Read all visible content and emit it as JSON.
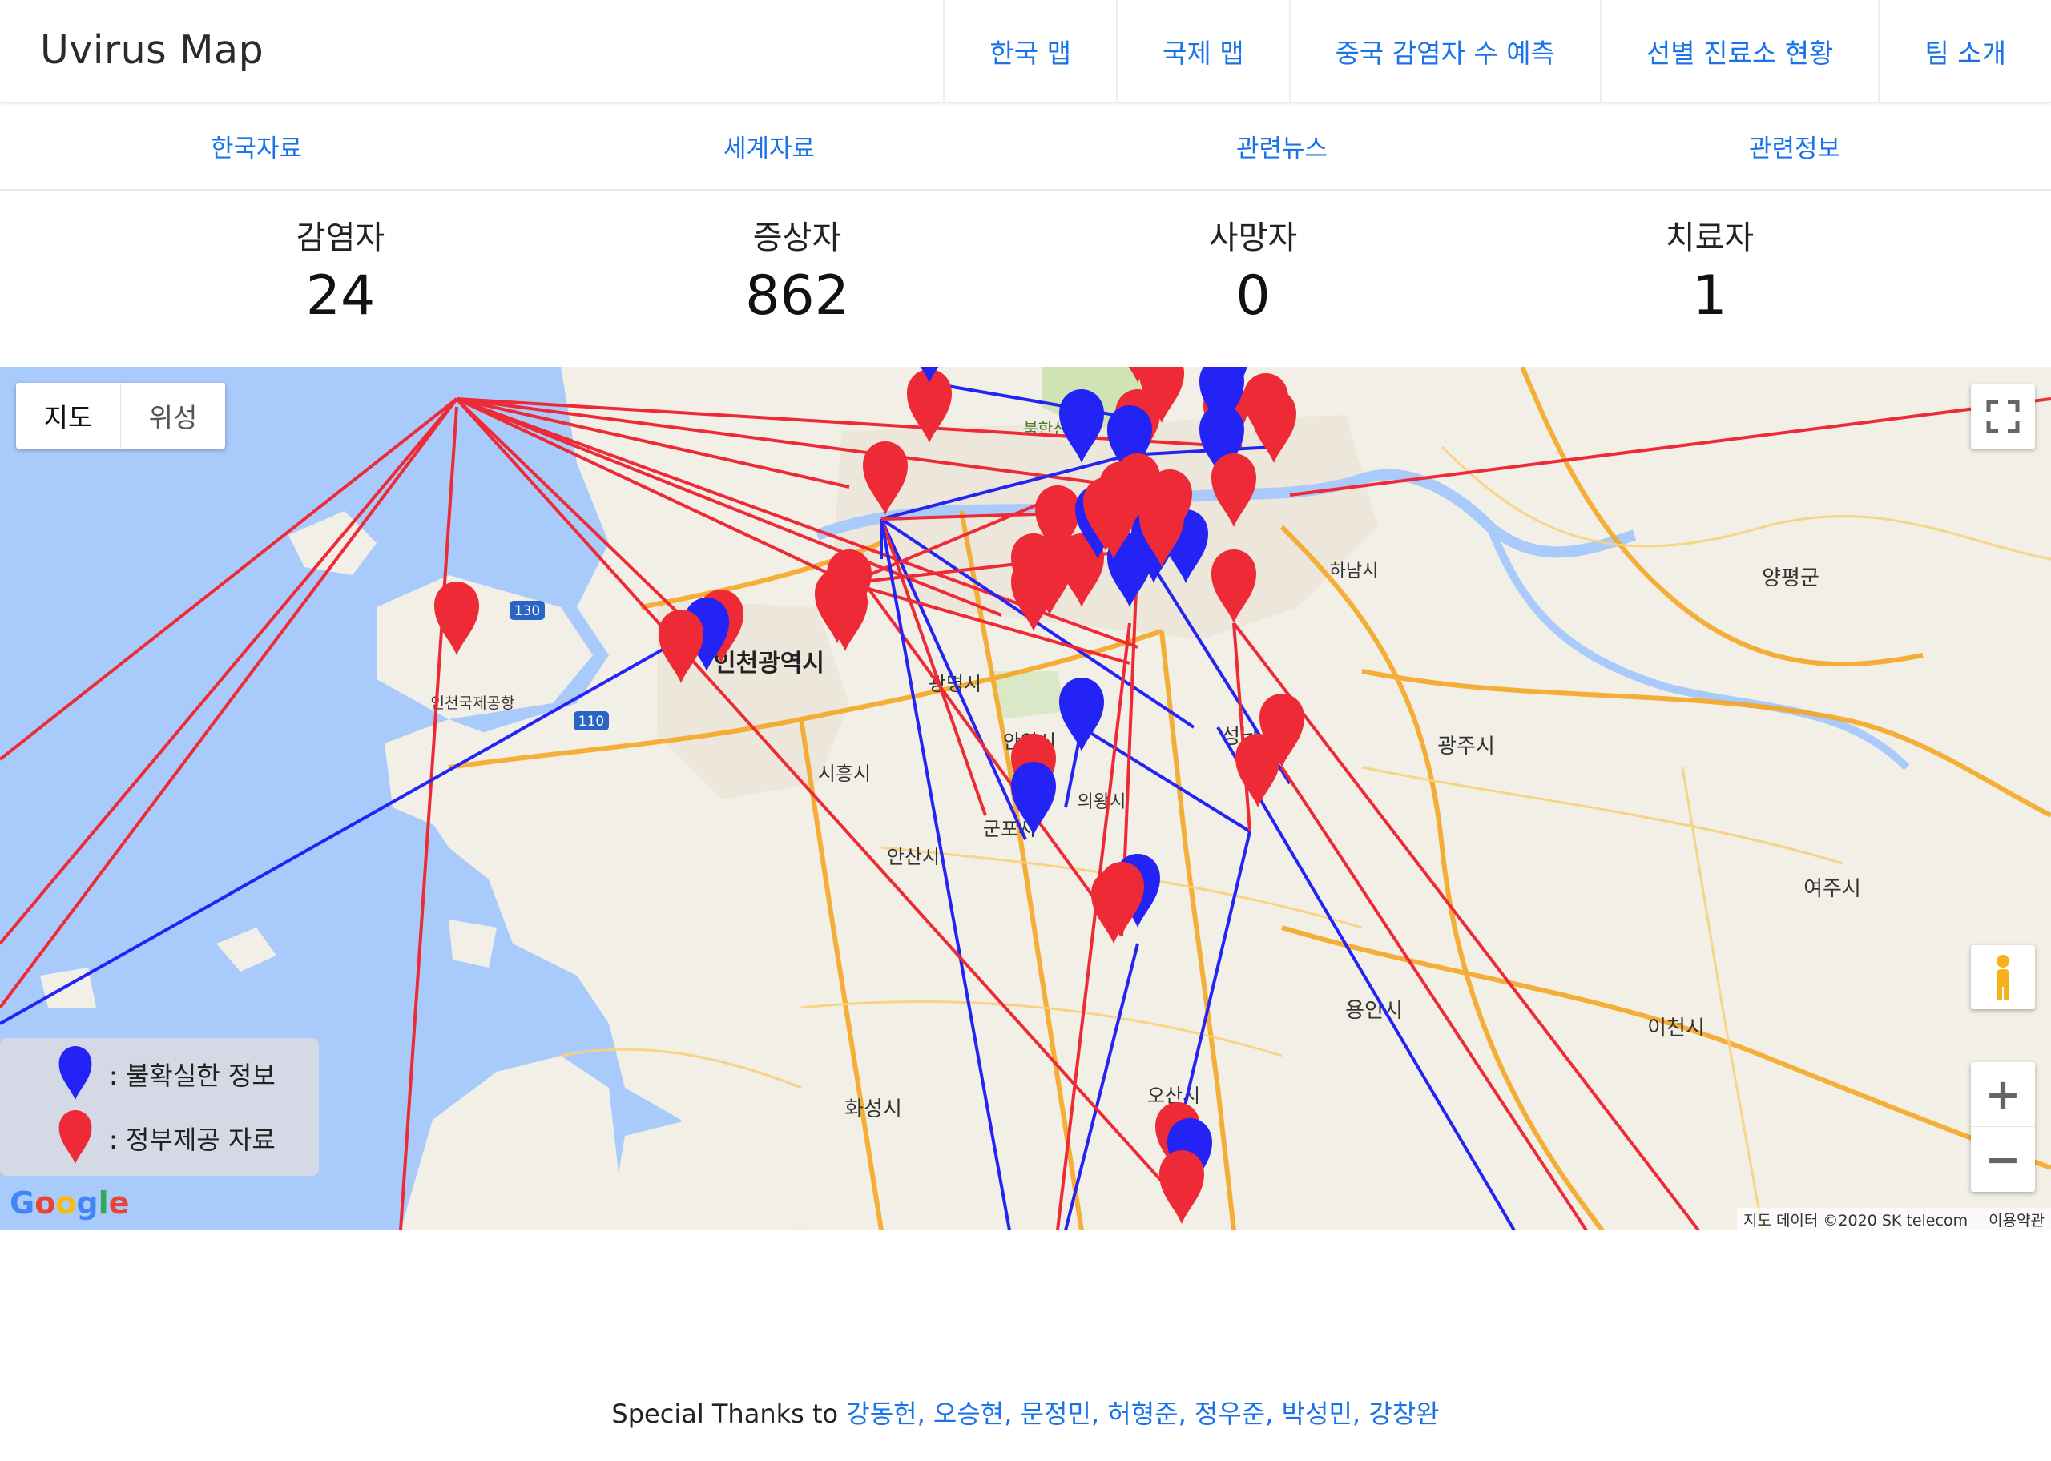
{
  "brand": "Uvirus Map",
  "nav": [
    "한국 맵",
    "국제 맵",
    "중국 감염자 수 예측",
    "선별 진료소 현황",
    "팀 소개"
  ],
  "subtabs": [
    "한국자료",
    "세계자료",
    "관련뉴스",
    "관련정보"
  ],
  "stats": [
    {
      "label": "감염자",
      "value": "24"
    },
    {
      "label": "증상자",
      "value": "862"
    },
    {
      "label": "사망자",
      "value": "0"
    },
    {
      "label": "치료자",
      "value": "1"
    }
  ],
  "map": {
    "type_buttons": [
      "지도",
      "위성"
    ],
    "legend": [
      {
        "color": "#2323f5",
        "text": ": 불확실한 정보"
      },
      {
        "color": "#ee2a36",
        "text": ": 정부제공 자료"
      }
    ],
    "place_labels": [
      "인천광역시",
      "인천국제공항",
      "광명시",
      "안양시",
      "시흥시",
      "군포시",
      "의왕시",
      "안산시",
      "화성시",
      "오산시",
      "용인시",
      "성남시",
      "광주시",
      "하남시",
      "양평군",
      "여주시",
      "이천시",
      "북한산",
      "130",
      "110"
    ],
    "attribution": [
      "지도 데이터 ©2020 SK telecom",
      "이용약관"
    ],
    "google": "Google",
    "colors": {
      "uncertain": "#2323f5",
      "official": "#ee2a36",
      "water": "#a9cbfb",
      "land": "#f2efe6"
    }
  },
  "footer": {
    "prefix": "Special Thanks to ",
    "names": "강동헌, 오승현, 문정민, 허형준, 정우준, 박성민, 강창완"
  }
}
